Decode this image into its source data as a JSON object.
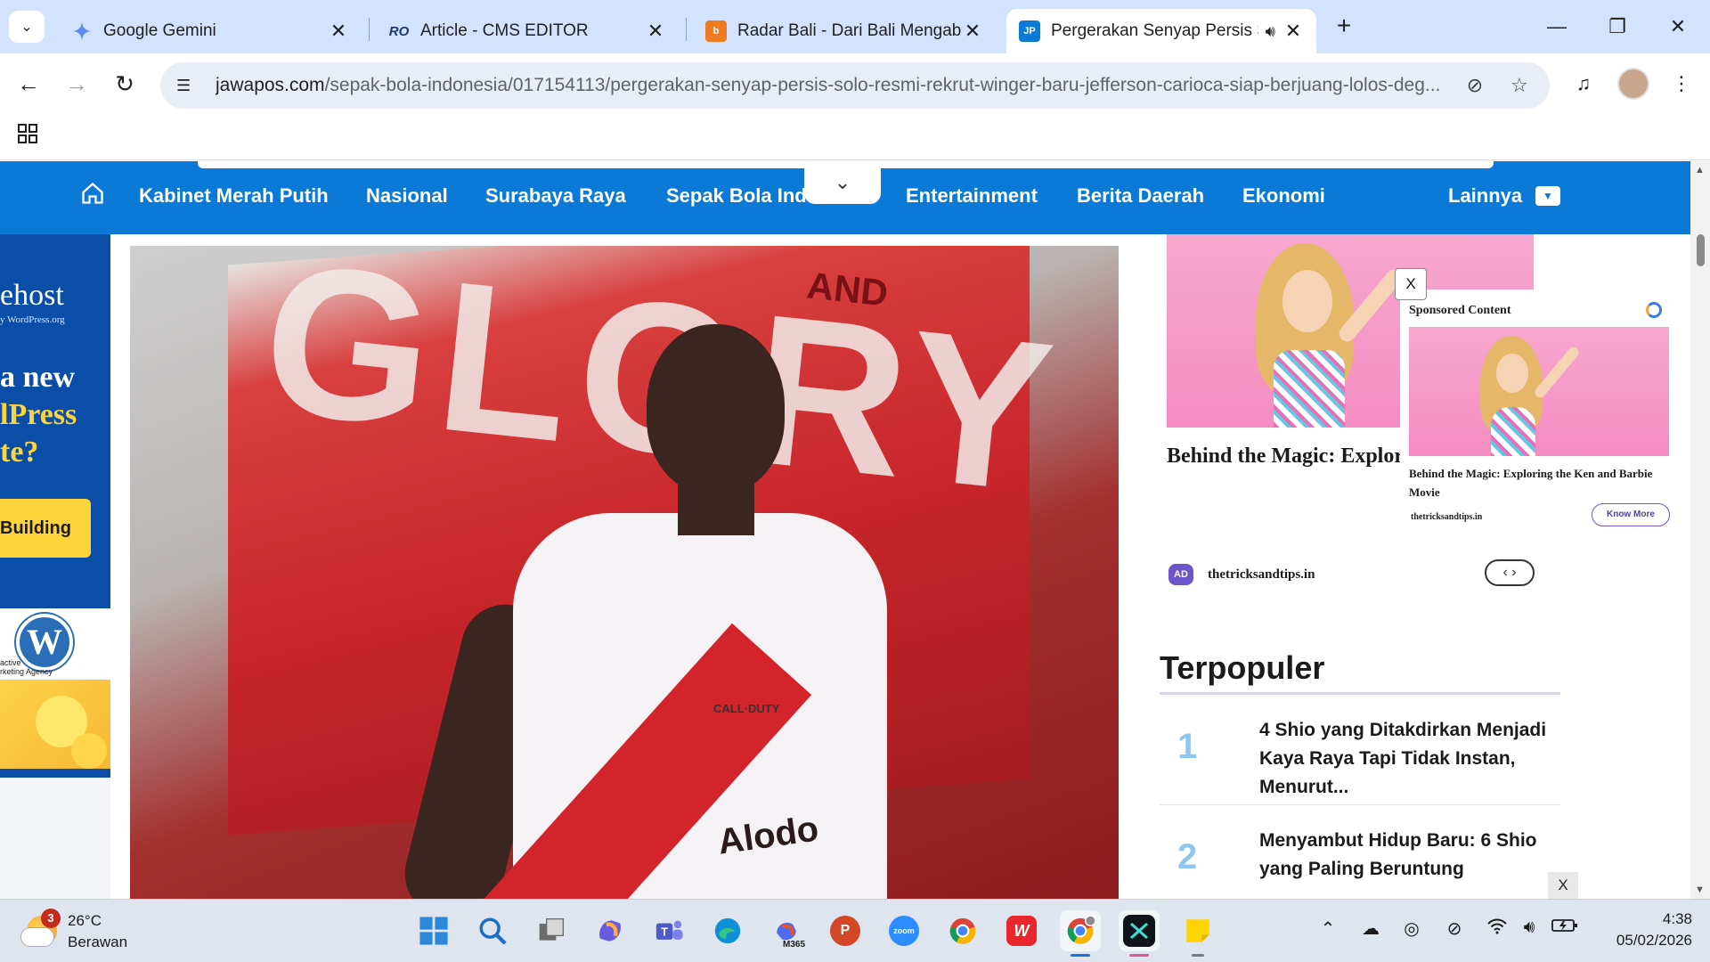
{
  "browser": {
    "tabs": [
      {
        "title": "Google Gemini",
        "favicon": "gemini-icon",
        "active": false
      },
      {
        "title": "Article - CMS EDITOR",
        "favicon": "ro-cms-icon",
        "active": false
      },
      {
        "title": "Radar Bali - Dari Bali Mengabar",
        "favicon": "radar-bali-icon",
        "active": false
      },
      {
        "title": "Pergerakan Senyap Persis Se",
        "favicon": "jawapos-icon",
        "active": true
      }
    ],
    "new_tab": "+",
    "window": {
      "minimize": "—",
      "restore": "❐",
      "close": "✕"
    },
    "url_host": "jawapos.com",
    "url_path": "/sepak-bola-indonesia/017154113/pergerakan-senyap-persis-solo-resmi-rekrut-winger-baru-jefferson-carioca-siap-berjuang-lolos-deg..."
  },
  "site_nav": {
    "items": [
      "Kabinet Merah Putih",
      "Nasional",
      "Surabaya Raya",
      "Sepak Bola Indonesia",
      "Entertainment",
      "Berita Daerah",
      "Ekonomi"
    ],
    "more": "Lainnya",
    "accent": "#0a7ad6"
  },
  "left_ad": {
    "brand": "ehost",
    "sub": "y WordPress.org",
    "headline_1": "a new",
    "headline_2": "lPress",
    "headline_3": "te?",
    "cta": "Building",
    "wp_logo": "W",
    "agency_1": "active",
    "agency_2": "rketing Agency"
  },
  "hero": {
    "flag_text": "GLORY",
    "and": "AND",
    "chest_logo": "CALL·DUTY",
    "sponsor": "Alodo"
  },
  "sponsored": {
    "close": "X",
    "label": "Sponsored Content",
    "title_main": "Behind the Magic: Exploring the Ken and Barbie Movie",
    "title_popup": "Behind the Magic: Exploring the Ken and Barbie Movie",
    "domain": "thetricksandtips.in",
    "cta": "Know More",
    "ad_badge": "AD"
  },
  "popular": {
    "heading": "Terpopuler",
    "items": [
      {
        "rank": "1",
        "title": "4 Shio yang Ditakdirkan Menjadi Kaya Raya Tapi Tidak Instan, Menurut..."
      },
      {
        "rank": "2",
        "title": "Menyambut Hidup Baru: 6 Shio yang Paling Beruntung"
      }
    ],
    "close": "X"
  },
  "taskbar": {
    "weather_badge": "3",
    "temperature": "26°C",
    "condition": "Berawan",
    "time": "4:38",
    "date": "05/02/2026",
    "apps": [
      "start-icon",
      "search-icon",
      "task-view-icon",
      "copilot-icon",
      "teams-icon",
      "edge-icon",
      "m365-icon",
      "powerpoint-icon",
      "zoom-icon",
      "chrome-icon",
      "wps-icon",
      "chrome-profile-icon",
      "capcut-icon",
      "sticky-notes-icon"
    ],
    "m365_label": "M365",
    "zoom_label": "zoom",
    "ppt_label": "P",
    "wps_label": "W"
  }
}
